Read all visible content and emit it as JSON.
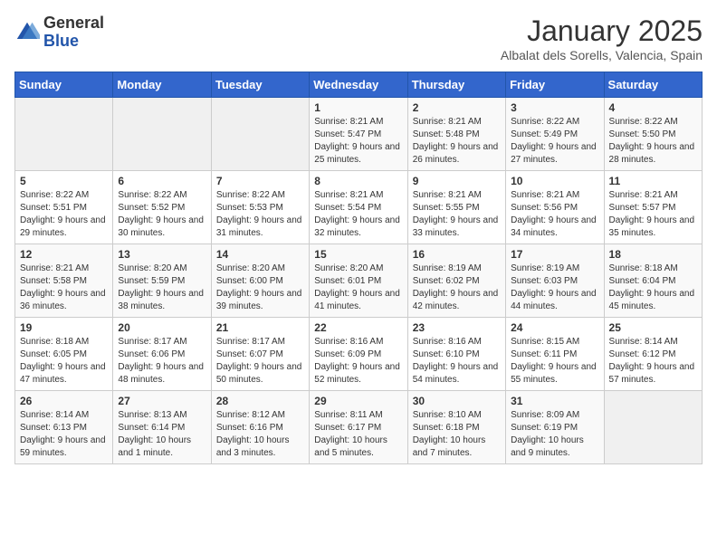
{
  "header": {
    "logo_general": "General",
    "logo_blue": "Blue",
    "month_title": "January 2025",
    "subtitle": "Albalat dels Sorells, Valencia, Spain"
  },
  "days_of_week": [
    "Sunday",
    "Monday",
    "Tuesday",
    "Wednesday",
    "Thursday",
    "Friday",
    "Saturday"
  ],
  "weeks": [
    [
      {
        "day": "",
        "info": ""
      },
      {
        "day": "",
        "info": ""
      },
      {
        "day": "",
        "info": ""
      },
      {
        "day": "1",
        "info": "Sunrise: 8:21 AM\nSunset: 5:47 PM\nDaylight: 9 hours and 25 minutes."
      },
      {
        "day": "2",
        "info": "Sunrise: 8:21 AM\nSunset: 5:48 PM\nDaylight: 9 hours and 26 minutes."
      },
      {
        "day": "3",
        "info": "Sunrise: 8:22 AM\nSunset: 5:49 PM\nDaylight: 9 hours and 27 minutes."
      },
      {
        "day": "4",
        "info": "Sunrise: 8:22 AM\nSunset: 5:50 PM\nDaylight: 9 hours and 28 minutes."
      }
    ],
    [
      {
        "day": "5",
        "info": "Sunrise: 8:22 AM\nSunset: 5:51 PM\nDaylight: 9 hours and 29 minutes."
      },
      {
        "day": "6",
        "info": "Sunrise: 8:22 AM\nSunset: 5:52 PM\nDaylight: 9 hours and 30 minutes."
      },
      {
        "day": "7",
        "info": "Sunrise: 8:22 AM\nSunset: 5:53 PM\nDaylight: 9 hours and 31 minutes."
      },
      {
        "day": "8",
        "info": "Sunrise: 8:21 AM\nSunset: 5:54 PM\nDaylight: 9 hours and 32 minutes."
      },
      {
        "day": "9",
        "info": "Sunrise: 8:21 AM\nSunset: 5:55 PM\nDaylight: 9 hours and 33 minutes."
      },
      {
        "day": "10",
        "info": "Sunrise: 8:21 AM\nSunset: 5:56 PM\nDaylight: 9 hours and 34 minutes."
      },
      {
        "day": "11",
        "info": "Sunrise: 8:21 AM\nSunset: 5:57 PM\nDaylight: 9 hours and 35 minutes."
      }
    ],
    [
      {
        "day": "12",
        "info": "Sunrise: 8:21 AM\nSunset: 5:58 PM\nDaylight: 9 hours and 36 minutes."
      },
      {
        "day": "13",
        "info": "Sunrise: 8:20 AM\nSunset: 5:59 PM\nDaylight: 9 hours and 38 minutes."
      },
      {
        "day": "14",
        "info": "Sunrise: 8:20 AM\nSunset: 6:00 PM\nDaylight: 9 hours and 39 minutes."
      },
      {
        "day": "15",
        "info": "Sunrise: 8:20 AM\nSunset: 6:01 PM\nDaylight: 9 hours and 41 minutes."
      },
      {
        "day": "16",
        "info": "Sunrise: 8:19 AM\nSunset: 6:02 PM\nDaylight: 9 hours and 42 minutes."
      },
      {
        "day": "17",
        "info": "Sunrise: 8:19 AM\nSunset: 6:03 PM\nDaylight: 9 hours and 44 minutes."
      },
      {
        "day": "18",
        "info": "Sunrise: 8:18 AM\nSunset: 6:04 PM\nDaylight: 9 hours and 45 minutes."
      }
    ],
    [
      {
        "day": "19",
        "info": "Sunrise: 8:18 AM\nSunset: 6:05 PM\nDaylight: 9 hours and 47 minutes."
      },
      {
        "day": "20",
        "info": "Sunrise: 8:17 AM\nSunset: 6:06 PM\nDaylight: 9 hours and 48 minutes."
      },
      {
        "day": "21",
        "info": "Sunrise: 8:17 AM\nSunset: 6:07 PM\nDaylight: 9 hours and 50 minutes."
      },
      {
        "day": "22",
        "info": "Sunrise: 8:16 AM\nSunset: 6:09 PM\nDaylight: 9 hours and 52 minutes."
      },
      {
        "day": "23",
        "info": "Sunrise: 8:16 AM\nSunset: 6:10 PM\nDaylight: 9 hours and 54 minutes."
      },
      {
        "day": "24",
        "info": "Sunrise: 8:15 AM\nSunset: 6:11 PM\nDaylight: 9 hours and 55 minutes."
      },
      {
        "day": "25",
        "info": "Sunrise: 8:14 AM\nSunset: 6:12 PM\nDaylight: 9 hours and 57 minutes."
      }
    ],
    [
      {
        "day": "26",
        "info": "Sunrise: 8:14 AM\nSunset: 6:13 PM\nDaylight: 9 hours and 59 minutes."
      },
      {
        "day": "27",
        "info": "Sunrise: 8:13 AM\nSunset: 6:14 PM\nDaylight: 10 hours and 1 minute."
      },
      {
        "day": "28",
        "info": "Sunrise: 8:12 AM\nSunset: 6:16 PM\nDaylight: 10 hours and 3 minutes."
      },
      {
        "day": "29",
        "info": "Sunrise: 8:11 AM\nSunset: 6:17 PM\nDaylight: 10 hours and 5 minutes."
      },
      {
        "day": "30",
        "info": "Sunrise: 8:10 AM\nSunset: 6:18 PM\nDaylight: 10 hours and 7 minutes."
      },
      {
        "day": "31",
        "info": "Sunrise: 8:09 AM\nSunset: 6:19 PM\nDaylight: 10 hours and 9 minutes."
      },
      {
        "day": "",
        "info": ""
      }
    ]
  ]
}
